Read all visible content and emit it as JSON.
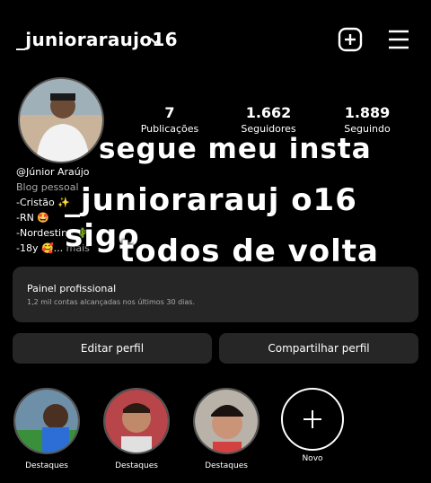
{
  "header": {
    "username": "_juniorarauj o16",
    "username_display": "_juniorarauj016"
  },
  "stats": [
    {
      "value": "7",
      "label": "Publicações"
    },
    {
      "value": "1.662",
      "label": "Seguidores"
    },
    {
      "value": "1.889",
      "label": "Seguindo"
    }
  ],
  "bio": {
    "name": "@Júnior Araújo",
    "category": "Blog pessoal",
    "lines": [
      "-Cristão ✨",
      "-RN 🤩",
      "-Nordestino 🌵",
      "-18y 🥰..."
    ],
    "more": "mais"
  },
  "overlay": {
    "line1": "segue meu insta",
    "line2": "_juniorarauj o16 sigo",
    "line3": "todos de volta"
  },
  "dashboard": {
    "title": "Painel profissional",
    "subtitle": "1,2 mil contas alcançadas nos últimos 30 dias."
  },
  "buttons": {
    "edit": "Editar perfil",
    "share": "Compartilhar perfil"
  },
  "highlights": [
    {
      "label": "Destaques"
    },
    {
      "label": "Destaques"
    },
    {
      "label": "Destaques"
    },
    {
      "label": "Novo"
    }
  ]
}
